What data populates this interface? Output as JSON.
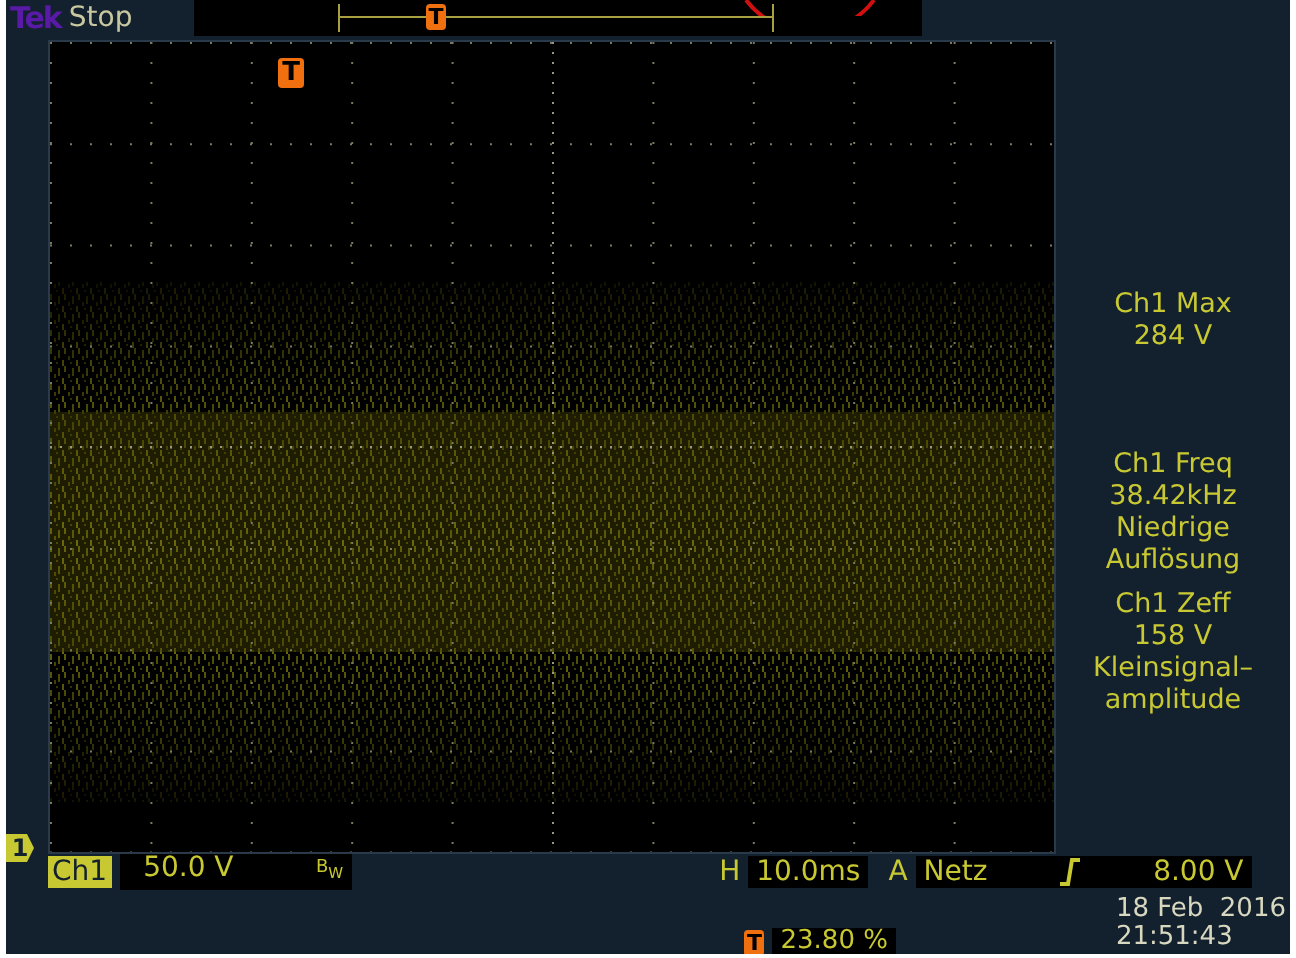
{
  "header": {
    "brand": "Tek",
    "status": "Stop",
    "record_marker": "T"
  },
  "graticule": {
    "trigger_marker": "T",
    "channel_marker": "1"
  },
  "measurements": [
    {
      "lines": [
        "Ch1 Max",
        "284 V"
      ]
    },
    {
      "lines": [
        "Ch1 Freq",
        "38.42kHz",
        "Niedrige",
        "Auflösung"
      ]
    },
    {
      "lines": [
        "Ch1 Zeff",
        "158 V",
        "Kleinsignal–",
        "amplitude"
      ]
    }
  ],
  "channel": {
    "label": "Ch1",
    "scale": "50.0 V",
    "bandwidth": "B$_{W}$"
  },
  "horizontal": {
    "label": "H",
    "value": "10.0ms"
  },
  "trigger": {
    "label": "A",
    "source": "Netz",
    "level": "8.00 V"
  },
  "trigger_position": {
    "marker": "T",
    "value": "23.80 %"
  },
  "date": "18 Feb  2016",
  "time": "21:51:43"
}
